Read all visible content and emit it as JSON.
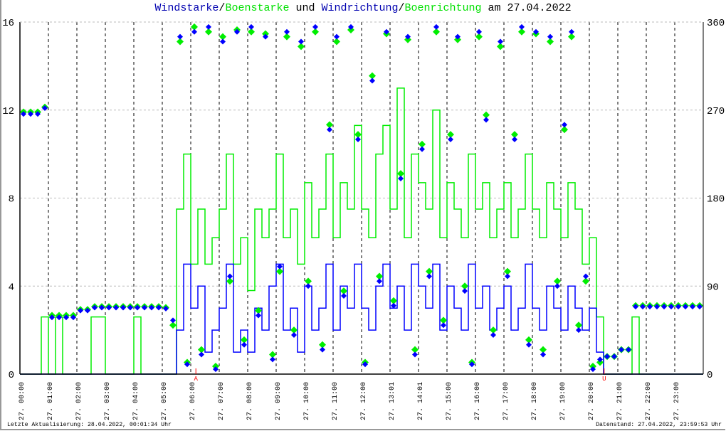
{
  "title": {
    "part1": "Windstarke",
    "sep1": "/",
    "part2": "Boenstarke",
    "mid": " und ",
    "part3": "Windrichtung",
    "sep2": "/",
    "part4": "Boenrichtung",
    "end": " am 27.04.2022"
  },
  "footer": {
    "left": "Letzte Aktualisierung: 28.04.2022, 00:01:34 Uhr",
    "right": "Datenstand: 27.04.2022, 23:59:53 Uhr"
  },
  "colors": {
    "speed": "#0000ff",
    "gust": "#00ee00",
    "title_blue": "#0000b0",
    "title_green": "#00e000",
    "marker": "#ff0000"
  },
  "chart_data": {
    "type": "line",
    "title": "Windstarke/Boenstarke und Windrichtung/Boenrichtung am 27.04.2022",
    "x_unit": "hour",
    "x_interval_minutes": 15,
    "xlim": [
      0,
      24
    ],
    "ylim_left": [
      0,
      16
    ],
    "ylim_right": [
      0,
      360
    ],
    "yticks_left": [
      "0",
      "4",
      "8",
      "12",
      "16"
    ],
    "yticks_right": [
      "0",
      "90",
      "180",
      "270",
      "360"
    ],
    "xtick_labels": [
      "27. 00:00",
      "27. 01:00",
      "27. 02:00",
      "27. 03:00",
      "27. 04:00",
      "27. 05:00",
      "27. 06:00",
      "27. 07:00",
      "27. 08:00",
      "27. 09:00",
      "27. 10:00",
      "27. 11:00",
      "27. 12:00",
      "27. 13:01",
      "27. 14:01",
      "27. 15:00",
      "27. 16:00",
      "27. 17:00",
      "27. 18:00",
      "27. 19:00",
      "27. 20:00",
      "27. 21:00",
      "27. 22:00",
      "27. 23:00"
    ],
    "grid": true,
    "annotations": [
      {
        "label": "A",
        "hour": 6.18
      },
      {
        "label": "U",
        "hour": 20.52
      }
    ],
    "series": [
      {
        "name": "Windstarke",
        "axis": "left",
        "style": "step",
        "values": [
          0,
          0,
          0,
          0,
          0,
          0,
          0,
          0,
          0,
          0,
          0,
          0,
          0,
          0,
          0,
          0,
          0,
          0,
          0,
          0,
          0,
          0,
          2,
          5,
          3,
          4,
          1,
          2,
          3,
          5,
          1,
          2,
          1,
          3,
          2,
          4,
          5,
          2,
          3,
          1,
          4,
          2,
          3,
          5,
          2,
          4,
          3,
          5,
          3,
          2,
          4,
          5,
          3,
          4,
          2,
          5,
          4,
          3,
          5,
          2,
          4,
          3,
          2,
          5,
          3,
          4,
          2,
          3,
          4,
          2,
          3,
          5,
          3,
          2,
          4,
          3,
          2,
          4,
          3,
          2,
          3,
          1,
          0,
          0,
          0,
          0,
          0,
          0,
          0,
          0,
          0,
          0,
          0,
          0,
          0,
          0
        ]
      },
      {
        "name": "Boenstarke",
        "axis": "left",
        "style": "step",
        "values": [
          0,
          0,
          0,
          2.6,
          0,
          2.6,
          0,
          0,
          0,
          0,
          2.6,
          2.6,
          0,
          0,
          0,
          0,
          2.6,
          0,
          0,
          0,
          0,
          0,
          7.5,
          10,
          5,
          7.5,
          5,
          6.2,
          7.5,
          10,
          5,
          6.2,
          3.8,
          7.5,
          6.2,
          7.5,
          10,
          6.2,
          7.5,
          5,
          8.7,
          6.2,
          7.5,
          10,
          6.2,
          8.7,
          7.5,
          11.3,
          7.5,
          6.2,
          10,
          11.3,
          7.5,
          13,
          6.2,
          10,
          8.7,
          7.5,
          12,
          6.2,
          8.7,
          7.5,
          6.2,
          10,
          7.5,
          8.7,
          6.2,
          7.5,
          8.7,
          6.2,
          7.5,
          10,
          7.5,
          6.2,
          8.7,
          7.5,
          6.2,
          8.7,
          7.5,
          5,
          6.2,
          2.6,
          0,
          0,
          0,
          0,
          2.6,
          0,
          0,
          0,
          0,
          0,
          0,
          0,
          0,
          0
        ]
      },
      {
        "name": "Windrichtung",
        "axis": "right",
        "style": "points",
        "values": [
          266,
          266,
          266,
          272,
          58,
          58,
          58,
          58,
          65,
          65,
          68,
          68,
          68,
          68,
          68,
          68,
          68,
          68,
          68,
          68,
          67,
          55,
          345,
          10,
          350,
          20,
          355,
          5,
          340,
          100,
          350,
          30,
          355,
          60,
          345,
          15,
          110,
          350,
          40,
          340,
          90,
          355,
          25,
          250,
          345,
          80,
          355,
          240,
          10,
          300,
          95,
          350,
          70,
          200,
          345,
          20,
          230,
          100,
          355,
          50,
          240,
          345,
          85,
          10,
          350,
          260,
          40,
          340,
          100,
          240,
          355,
          30,
          350,
          20,
          345,
          90,
          255,
          350,
          45,
          100,
          5,
          15,
          18,
          18,
          25,
          25,
          69,
          69,
          69,
          69,
          69,
          69,
          69,
          69,
          69,
          69
        ]
      },
      {
        "name": "Boenrichtung",
        "axis": "right",
        "style": "points",
        "values": [
          268,
          268,
          268,
          273,
          60,
          60,
          60,
          60,
          66,
          66,
          69,
          69,
          69,
          69,
          69,
          69,
          69,
          69,
          69,
          69,
          68,
          50,
          340,
          12,
          355,
          25,
          350,
          8,
          345,
          95,
          352,
          35,
          350,
          65,
          348,
          20,
          105,
          345,
          45,
          335,
          95,
          350,
          30,
          255,
          340,
          85,
          352,
          245,
          12,
          305,
          100,
          348,
          75,
          205,
          342,
          25,
          235,
          105,
          350,
          55,
          245,
          342,
          90,
          12,
          345,
          265,
          45,
          335,
          105,
          245,
          350,
          35,
          348,
          25,
          340,
          95,
          250,
          345,
          50,
          95,
          8,
          12,
          18,
          18,
          25,
          25,
          70,
          70,
          70,
          70,
          70,
          70,
          70,
          70,
          70,
          70
        ]
      }
    ]
  }
}
